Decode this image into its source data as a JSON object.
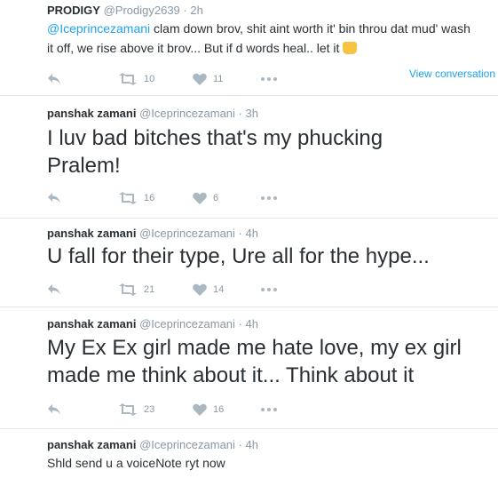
{
  "tweets": [
    {
      "name": "PRODIGY",
      "handle": "@Prodigy2639",
      "time": "· 2h",
      "mention": "@Iceprincezamani",
      "text": " clam down brov, shit aint worth it' bin throu dat mud' wash it off, we rise above it brov... But if d words heal.. let it",
      "emoji": "fist-emoji",
      "view_conversation": "View conversation",
      "retweets": "10",
      "likes": "11"
    },
    {
      "name": "panshak zamani",
      "handle": "@Iceprincezamani",
      "time": "· 3h",
      "text": "I luv bad bitches that's my phucking Pralem!",
      "retweets": "16",
      "likes": "6"
    },
    {
      "name": "panshak zamani",
      "handle": "@Iceprincezamani",
      "time": "· 4h",
      "text": "U fall for their type, Ure all for the hype...",
      "retweets": "21",
      "likes": "14"
    },
    {
      "name": "panshak zamani",
      "handle": "@Iceprincezamani",
      "time": "· 4h",
      "text": "My Ex Ex girl made me hate love, my ex girl made me think about it... Think about it",
      "retweets": "23",
      "likes": "16"
    },
    {
      "name": "panshak zamani",
      "handle": "@Iceprincezamani",
      "time": "· 4h",
      "text": "Shld send u a voiceNote ryt now"
    }
  ],
  "icons": {
    "reply": "reply-icon",
    "retweet": "retweet-icon",
    "like": "heart-icon",
    "more": "more-icon"
  },
  "colors": {
    "link": "#1da1f2",
    "muted": "#8899a6",
    "icon": "#aab8c2"
  }
}
